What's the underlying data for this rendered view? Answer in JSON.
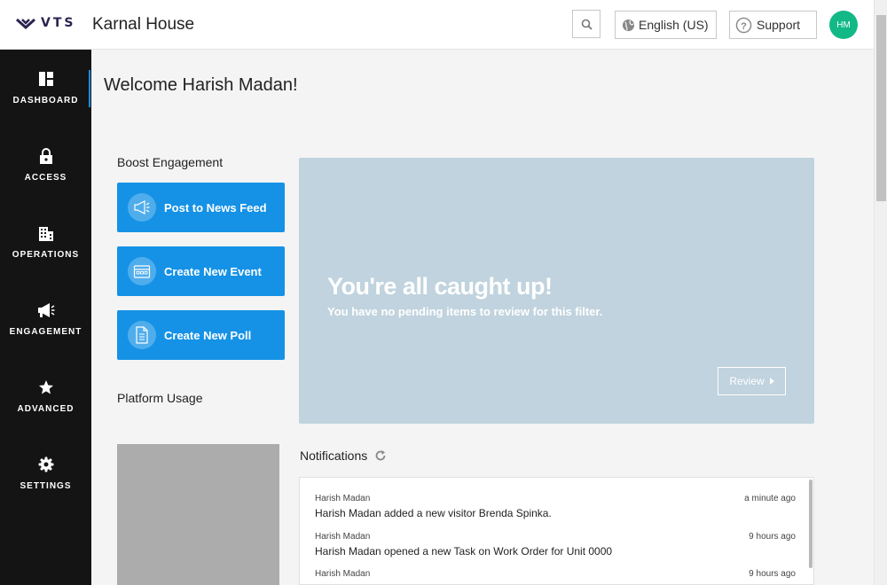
{
  "header": {
    "logo_text": "VTS",
    "site_title": "Karnal House",
    "language_label": "English (US)",
    "support_label": "Support",
    "avatar_initials": "HM"
  },
  "sidebar": {
    "items": [
      {
        "label": "DASHBOARD",
        "icon": "dashboard-icon",
        "active": true
      },
      {
        "label": "ACCESS",
        "icon": "lock-icon"
      },
      {
        "label": "OPERATIONS",
        "icon": "building-icon"
      },
      {
        "label": "ENGAGEMENT",
        "icon": "megaphone-icon"
      },
      {
        "label": "ADVANCED",
        "icon": "star-icon"
      },
      {
        "label": "SETTINGS",
        "icon": "gear-icon"
      }
    ]
  },
  "main": {
    "welcome": "Welcome Harish Madan!",
    "boost_title": "Boost Engagement",
    "actions": [
      {
        "label": "Post to News Feed",
        "icon": "megaphone-icon"
      },
      {
        "label": "Create New Event",
        "icon": "calendar-icon"
      },
      {
        "label": "Create New Poll",
        "icon": "document-icon"
      }
    ],
    "platform_usage_title": "Platform Usage",
    "review_panel": {
      "title": "You're all caught up!",
      "subtitle": "You have no pending items to review for this filter.",
      "button_label": "Review"
    },
    "notifications": {
      "title": "Notifications",
      "items": [
        {
          "user": "Harish Madan",
          "time": "a minute ago",
          "message": "Harish Madan added a new visitor Brenda Spinka."
        },
        {
          "user": "Harish Madan",
          "time": "9 hours ago",
          "message": "Harish Madan opened a new Task on Work Order for Unit 0000"
        },
        {
          "user": "Harish Madan",
          "time": "9 hours ago",
          "message": ""
        }
      ]
    }
  },
  "colors": {
    "accent": "#1592e6",
    "sidebar_bg": "#141414",
    "review_panel_bg": "#c0d3de",
    "avatar_bg": "#12b886"
  }
}
